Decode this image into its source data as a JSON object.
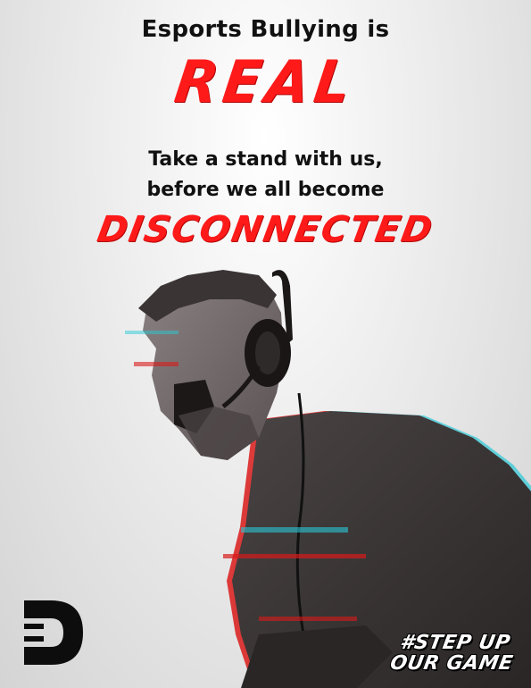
{
  "poster": {
    "line1": "Esports Bullying is",
    "line2": "REAL",
    "line3": "Take a stand with us,",
    "line4": "before we all become",
    "line5": "DISCONNECTED",
    "hashtag_line1": "#STEP UP",
    "hashtag_line2": "OUR GAME"
  },
  "colors": {
    "accent_red": "#ff1a1a",
    "text_dark": "#111111",
    "background": "#d9d9d9",
    "glitch_cyan": "#29c7d6"
  },
  "icons": {
    "logo": "disconnected-d-plug-logo",
    "photo": "screaming-gamer-with-headset-glitch-photo"
  }
}
